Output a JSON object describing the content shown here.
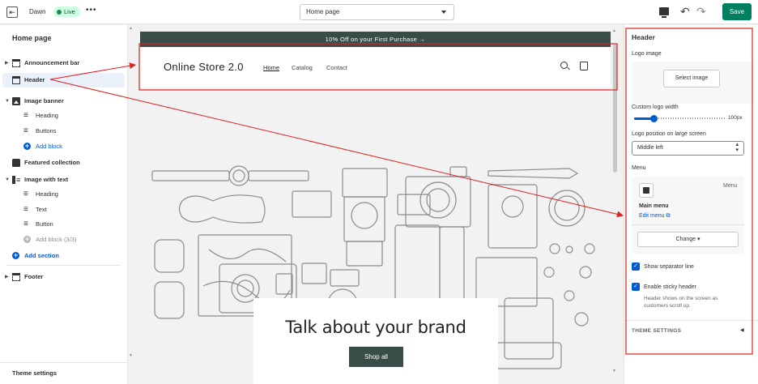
{
  "topbar": {
    "theme_name": "Dawn",
    "live_badge": "Live",
    "more_label": "•••",
    "page_select": "Home page",
    "undo_icon": "↶",
    "redo_icon": "↷",
    "save_label": "Save"
  },
  "sidebar": {
    "title": "Home page",
    "sections": [
      {
        "label": "Announcement bar",
        "icon": "layout-top-icon"
      },
      {
        "label": "Header",
        "icon": "layout-header-icon"
      },
      {
        "label": "Image banner",
        "icon": "image-icon"
      },
      {
        "label": "Heading",
        "icon": "text-icon"
      },
      {
        "label": "Buttons",
        "icon": "text-icon"
      },
      {
        "label": "Add block",
        "icon": "plus-circle-icon"
      },
      {
        "label": "Featured collection",
        "icon": "collection-icon"
      },
      {
        "label": "Image with text",
        "icon": "image-text-icon"
      },
      {
        "label": "Heading",
        "icon": "text-icon"
      },
      {
        "label": "Text",
        "icon": "text-icon"
      },
      {
        "label": "Button",
        "icon": "text-icon"
      },
      {
        "label": "Add block (3/3)",
        "icon": "plus-circle-icon"
      },
      {
        "label": "Add section",
        "icon": "plus-circle-icon"
      },
      {
        "label": "Footer",
        "icon": "layout-footer-icon"
      }
    ],
    "footer_label": "Theme settings"
  },
  "preview": {
    "announcement": "10% Off on your First Purchase  →",
    "store_name": "Online Store 2.0",
    "nav": [
      "Home",
      "Catalog",
      "Contact"
    ],
    "brand_title": "Talk about your brand",
    "shop_button": "Shop all"
  },
  "settings": {
    "title": "Header",
    "logo_image_label": "Logo image",
    "select_image": "Select image",
    "logo_width_label": "Custom logo width",
    "logo_width_value": "100px",
    "logo_width_fraction": 0.22,
    "logo_position_label": "Logo position on large screen",
    "logo_position_value": "Middle left",
    "menu_label": "Menu",
    "menu_tag": "Menu",
    "menu_name": "Main menu",
    "menu_edit": "Edit menu",
    "change_button": "Change",
    "show_separator": "Show separator line",
    "sticky_header": "Enable sticky header",
    "sticky_help": "Header shows on the screen as customers scroll up.",
    "theme_settings": "THEME SETTINGS"
  },
  "colors": {
    "accent_green": "#008060",
    "brand_dark": "#384d48",
    "link_blue": "#005bd3",
    "annotation_red": "#e02020"
  }
}
